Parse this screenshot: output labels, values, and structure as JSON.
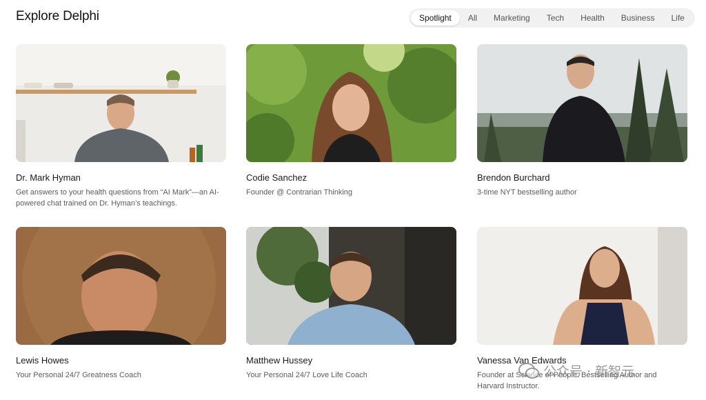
{
  "header": {
    "title": "Explore Delphi"
  },
  "filters": {
    "active": "Spotlight",
    "tabs": [
      "Spotlight",
      "All",
      "Marketing",
      "Tech",
      "Health",
      "Business",
      "Life"
    ]
  },
  "cards": [
    {
      "name": "Dr. Mark Hyman",
      "description": "Get answers to your health questions from “AI Mark”—an AI-powered chat trained on Dr. Hyman’s teachings."
    },
    {
      "name": "Codie Sanchez",
      "description": "Founder @ Contrarian Thinking"
    },
    {
      "name": "Brendon Burchard",
      "description": "3-time NYT bestselling author"
    },
    {
      "name": "Lewis Howes",
      "description": "Your Personal 24/7 Greatness Coach"
    },
    {
      "name": "Matthew Hussey",
      "description": "Your Personal 24/7 Love Life Coach"
    },
    {
      "name": "Vanessa Van Edwards",
      "description": "Founder at Science of People. Bestselling Author and Harvard Instructor."
    }
  ],
  "watermark": {
    "text": "公众号 · 新智元"
  },
  "colors": {
    "background": "#ffffff",
    "filter_bar": "#f1f1f1",
    "active_tab": "#ffffff",
    "text_primary": "#1a1a1a",
    "text_secondary": "#5b5b5b"
  }
}
